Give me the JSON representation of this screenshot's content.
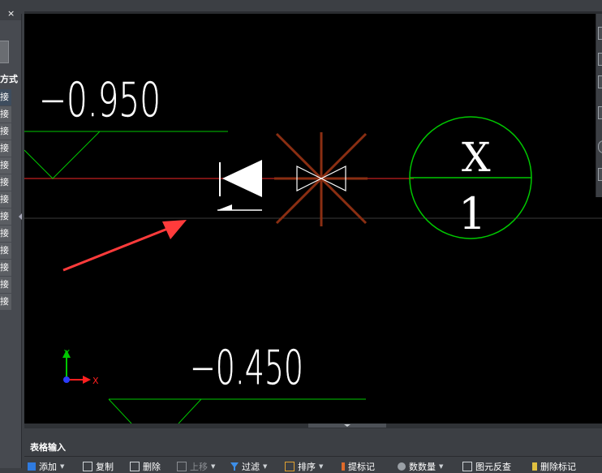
{
  "left_panel": {
    "close_glyph": "×",
    "column_header": "方式",
    "rows": [
      "接",
      "接",
      "接",
      "接",
      "接",
      "接",
      "接",
      "接",
      "接",
      "接",
      "接",
      "接",
      "接"
    ]
  },
  "drawing": {
    "upper_elevation": "−0.950",
    "lower_elevation": "−0.450",
    "axis_bubble_top": "X",
    "axis_bubble_bottom": "1",
    "ucs_y": "Y",
    "ucs_x": "X",
    "colors": {
      "pipe_red": "#7a1414",
      "green": "#00c800",
      "valve_brown": "#8a2e12",
      "arrow_red": "#ff3b3b",
      "text_white": "#ffffff"
    }
  },
  "bottom_panel": {
    "title": "表格输入",
    "tools": [
      {
        "label": "添加",
        "icon": "plus-icon"
      },
      {
        "label": "复制",
        "icon": "copy-icon"
      },
      {
        "label": "删除",
        "icon": "delete-icon"
      },
      {
        "label": "上移",
        "icon": "move-up-icon"
      },
      {
        "label": "过滤",
        "icon": "filter-icon"
      },
      {
        "label": "排序",
        "icon": "sort-icon"
      },
      {
        "label": "提标记",
        "icon": "mark-icon"
      },
      {
        "label": "数数量",
        "icon": "count-icon"
      },
      {
        "label": "图元反查",
        "icon": "reverse-lookup-icon"
      },
      {
        "label": "删除标记",
        "icon": "erase-mark-icon"
      }
    ]
  }
}
